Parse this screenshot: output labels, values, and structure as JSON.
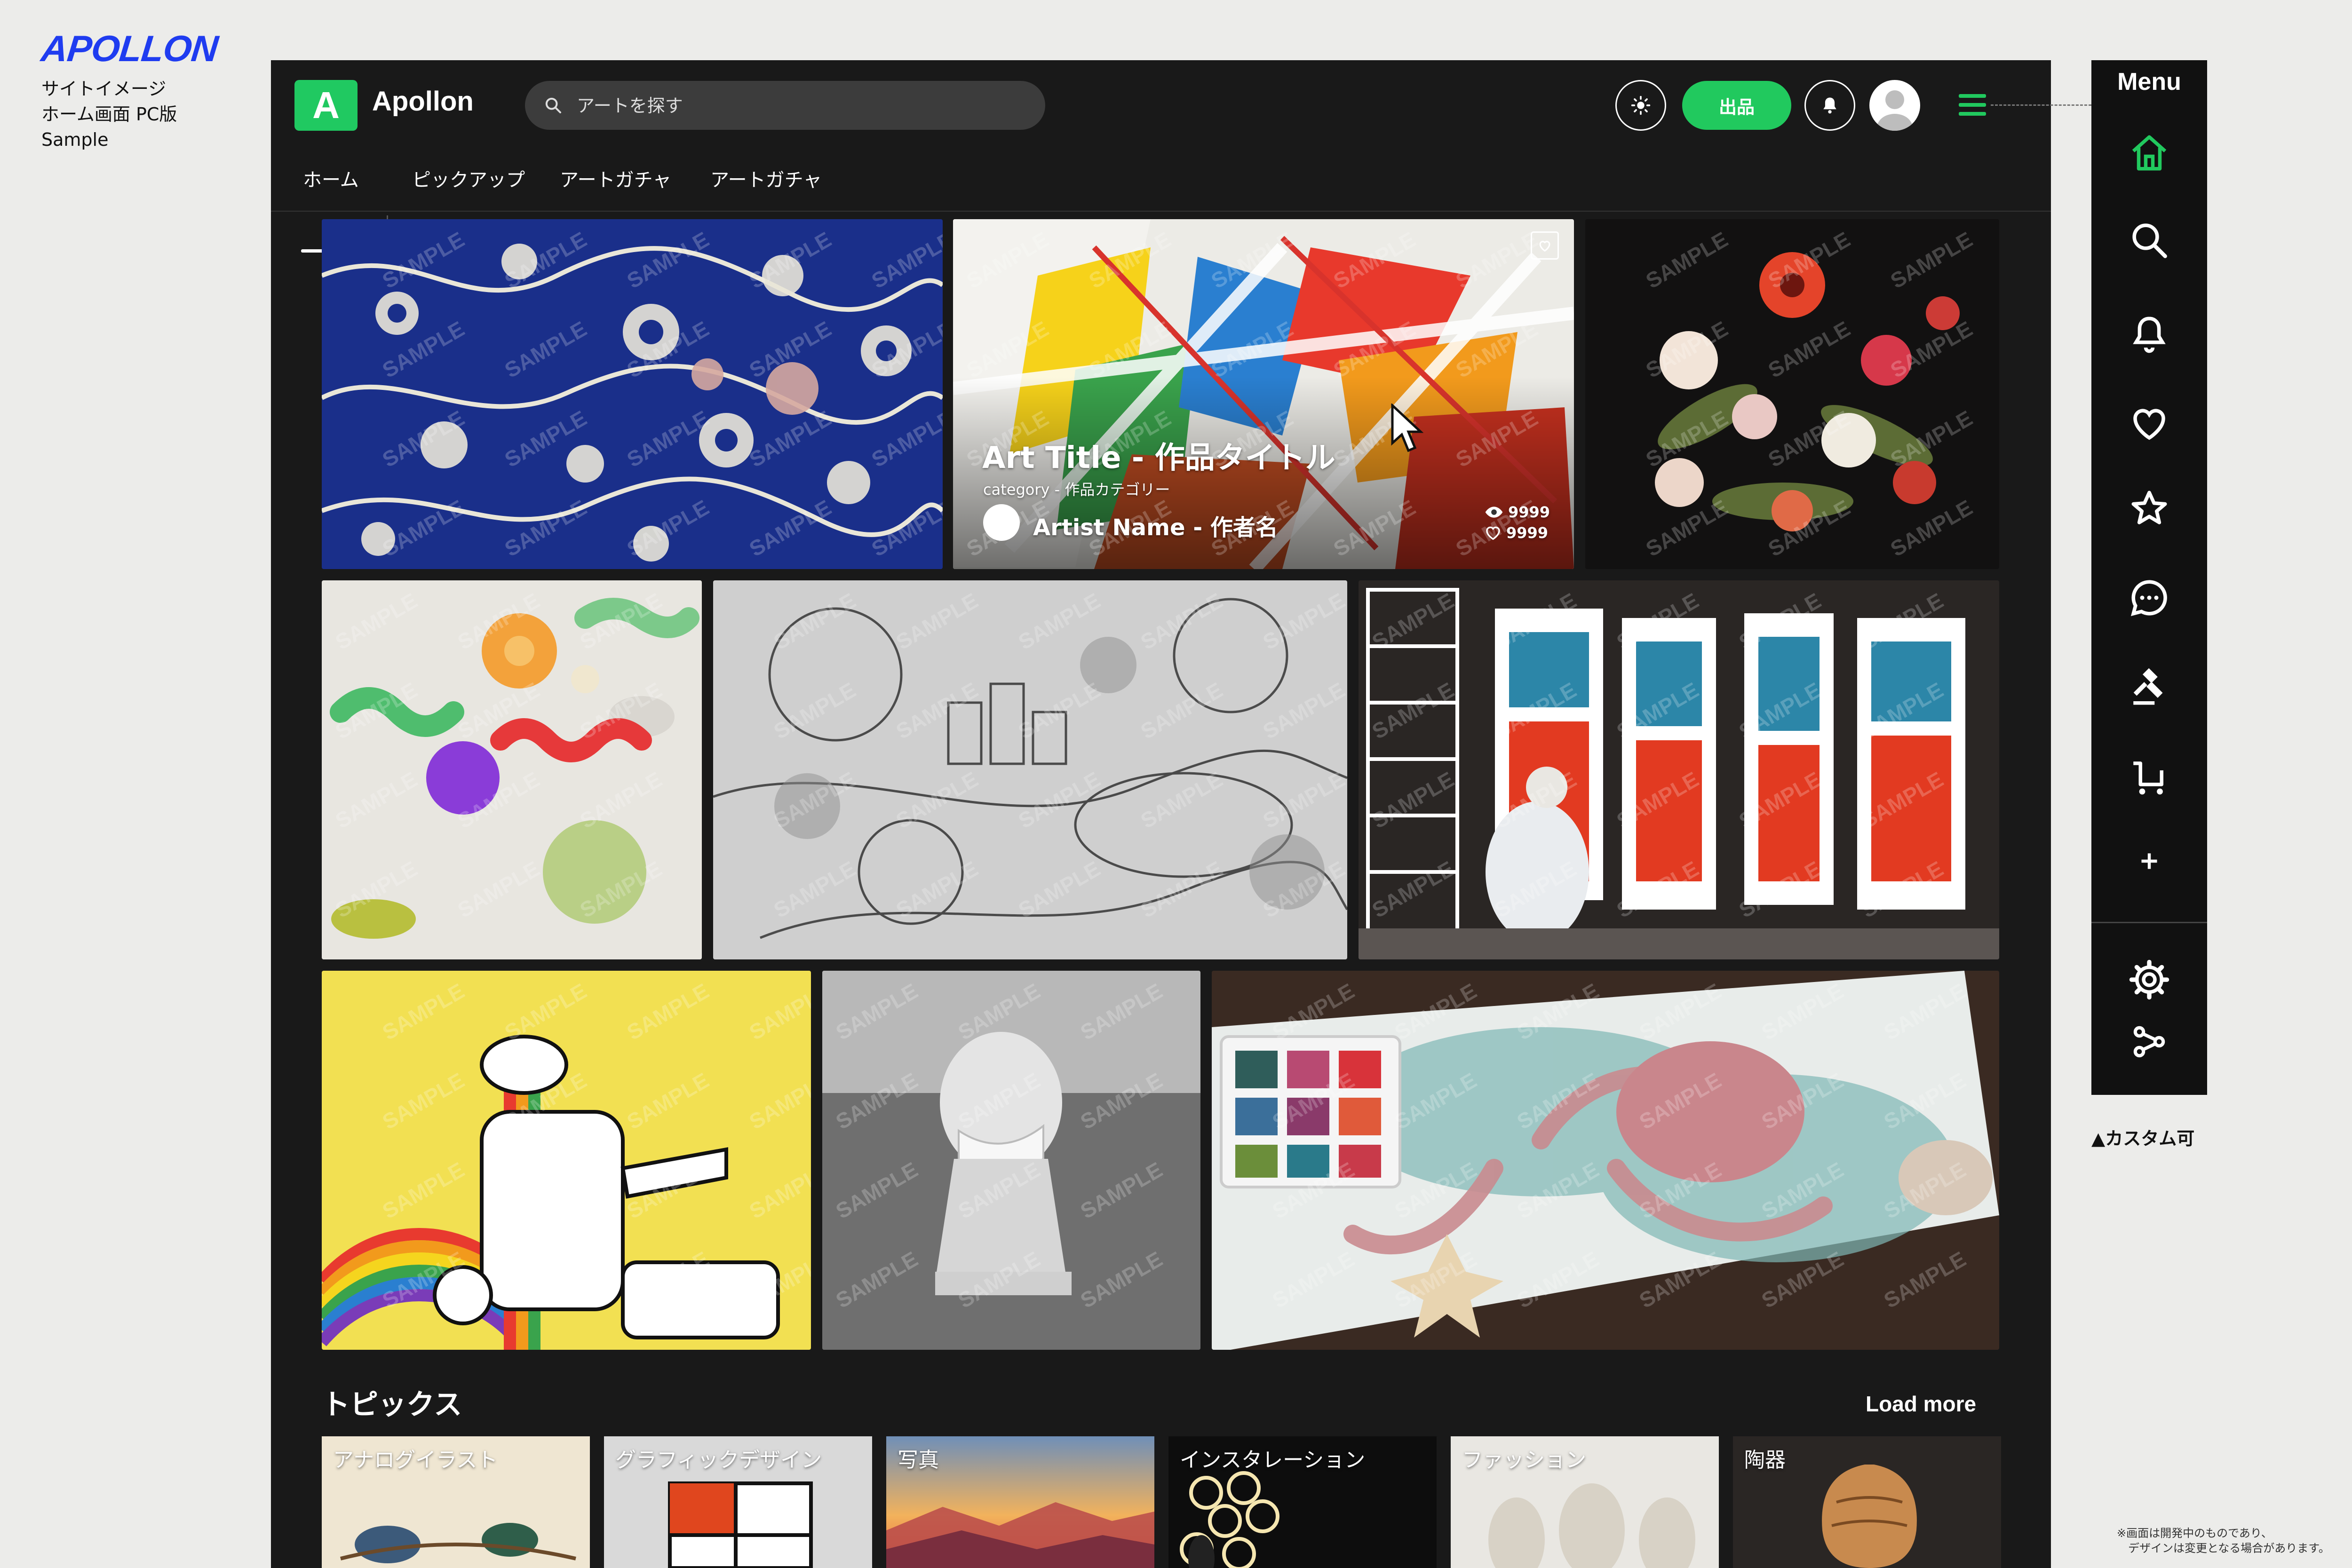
{
  "left_info": {
    "logo_text": "APOLLON",
    "lines": [
      "サイトイメージ",
      "ホーム画面 PC版",
      "Sample"
    ]
  },
  "header": {
    "app_logo_letter": "A",
    "app_name": "Apollon",
    "search_placeholder": "アートを探す",
    "post_label": "出品",
    "theme_icon": "sun-icon",
    "bell_icon": "bell-icon",
    "menu_icon": "hamburger-icon"
  },
  "tabs": [
    {
      "label": "ホーム",
      "active": true
    },
    {
      "label": "ピックアップ"
    },
    {
      "label": "アートガチャ"
    },
    {
      "label": "アートガチャ"
    }
  ],
  "featured": {
    "title": "Art Title - 作品タイトル",
    "category": "category - 作品カテゴリー",
    "artist": "Artist Name - 作者名",
    "views": "9999",
    "likes": "9999"
  },
  "watermark": "SAMPLE",
  "topics": {
    "title": "トピックス",
    "load_more": "Load more",
    "items": [
      {
        "label": "アナログイラスト"
      },
      {
        "label": "グラフィックデザイン"
      },
      {
        "label": "写真"
      },
      {
        "label": "インスタレーション"
      },
      {
        "label": "ファッション"
      },
      {
        "label": "陶器"
      }
    ]
  },
  "side_menu": {
    "title": "Menu",
    "icons": [
      "home-icon",
      "search-icon",
      "bell-icon",
      "heart-icon",
      "star-icon",
      "chat-icon",
      "gavel-icon",
      "cart-icon",
      "plus-icon",
      "gear-icon",
      "share-icon"
    ],
    "custom_note": "▲カスタム可"
  },
  "footnote": {
    "line1": "※画面は開発中のものであり、",
    "line2": "デザインは変更となる場合があります。"
  },
  "colors": {
    "accent": "#21c95e",
    "brand_blue": "#1f3cf0",
    "app_bg": "#191919"
  }
}
